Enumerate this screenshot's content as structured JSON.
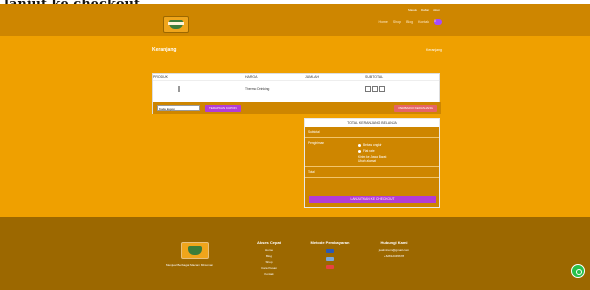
{
  "window_caption": "lanjut ke checkout.",
  "header": {
    "account_links": [
      "Masuk",
      "Daftar",
      "Akun"
    ],
    "nav_links": [
      "Home",
      "Shop",
      "Blog",
      "Kontak"
    ],
    "cart_count": "0"
  },
  "page": {
    "title": "Keranjang",
    "breadcrumb": "Keranjang"
  },
  "cart": {
    "headers": [
      "PRODUK",
      "HARGA",
      "JUMLAH",
      "SUBTOTAL"
    ],
    "product": "Thermo Drinking",
    "coupon_placeholder": "Kode kupon",
    "apply_button": "TERAPKAN KUPON",
    "update_button": "PERBARUI KERANJANG"
  },
  "summary": {
    "title": "TOTAL KERANJANG BELANJA",
    "subtotal_label": "Subtotal",
    "shipping_label": "Pengiriman",
    "shipping_option1": "Bebas ongkir",
    "shipping_option2": "Flat rate",
    "shipping_destination": "Kirim ke Jawa Barat",
    "change_address": "Ubah alamat",
    "total_label": "Total",
    "checkout_button": "LANJUTKAN KE CHECKOUT"
  },
  "footer": {
    "tagline": "Menjual Berbagai Macam Minuman",
    "links_title": "Akses Cepat",
    "links": [
      "Home",
      "Blog",
      "Shop",
      "Cara Pesan",
      "Kontak"
    ],
    "payment_title": "Metode Pembayaran",
    "contact_title": "Hubungi Kami",
    "email": "jualminum@gmail.com",
    "phone": "+62812345678"
  },
  "colors": {
    "header": "#ce8600",
    "page": "#efa000",
    "accent": "#b33cd5",
    "footer": "#9c6800",
    "whatsapp": "#28c14b"
  }
}
